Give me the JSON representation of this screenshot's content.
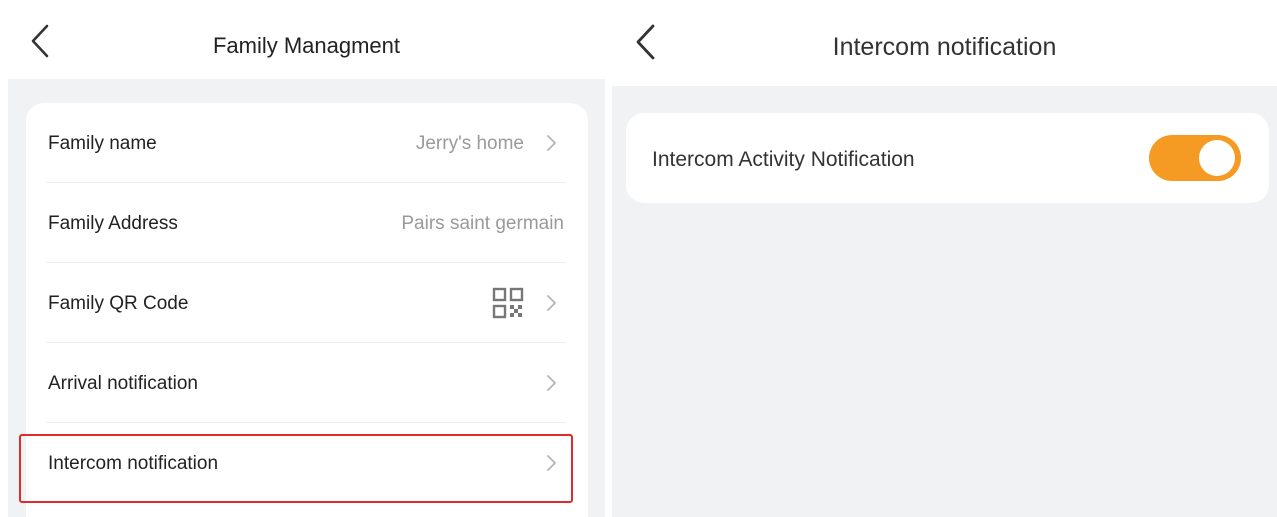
{
  "left_screen": {
    "title": "Family Managment",
    "rows": [
      {
        "label": "Family name",
        "value": "Jerry's home",
        "chevron": true
      },
      {
        "label": "Family Address",
        "value": "Pairs saint germain",
        "chevron": false
      },
      {
        "label": "Family QR Code",
        "value": "",
        "icon": "qr-code-icon",
        "chevron": true
      },
      {
        "label": "Arrival notification",
        "value": "",
        "chevron": true
      },
      {
        "label": "Intercom notification",
        "value": "",
        "chevron": true,
        "highlighted": true
      }
    ],
    "highlight_color": "#e12a2a"
  },
  "right_screen": {
    "title": "Intercom notification",
    "setting_label": "Intercom Activity Notification",
    "toggle_on": true,
    "toggle_color": "#f59a23"
  },
  "icons": {
    "back": "back-arrow-icon",
    "chevron": "chevron-right-icon"
  }
}
